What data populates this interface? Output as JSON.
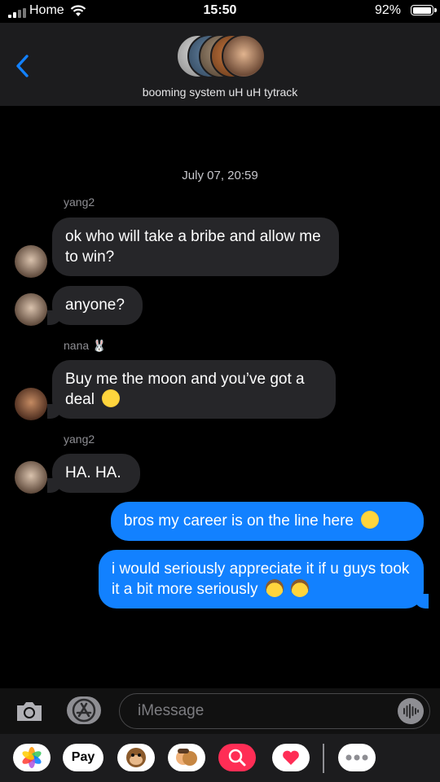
{
  "status_bar": {
    "carrier": "Home",
    "time": "15:50",
    "battery": "92%"
  },
  "header": {
    "group_name": "booming system uH uH tytrack"
  },
  "thread": {
    "timestamp": "July 07, 20:59",
    "groups": [
      {
        "sender": "yang2",
        "messages": [
          "ok who will take a bribe and allow me to win?",
          "anyone?"
        ]
      },
      {
        "sender": "nana 🐰",
        "messages": [
          "Buy me the moon and you’ve got a deal"
        ]
      },
      {
        "sender": "yang2",
        "messages": [
          "HA. HA."
        ]
      }
    ],
    "outgoing": [
      "bros my career is on the line here",
      "i would seriously appreciate it if u guys took it a bit more seriously"
    ]
  },
  "composer": {
    "placeholder": "iMessage"
  },
  "app_drawer": {
    "apple_pay_label": "Pay"
  },
  "colors": {
    "accent": "#1281ff",
    "incoming_bubble": "#262629",
    "header_bg": "#1c1c1e"
  }
}
